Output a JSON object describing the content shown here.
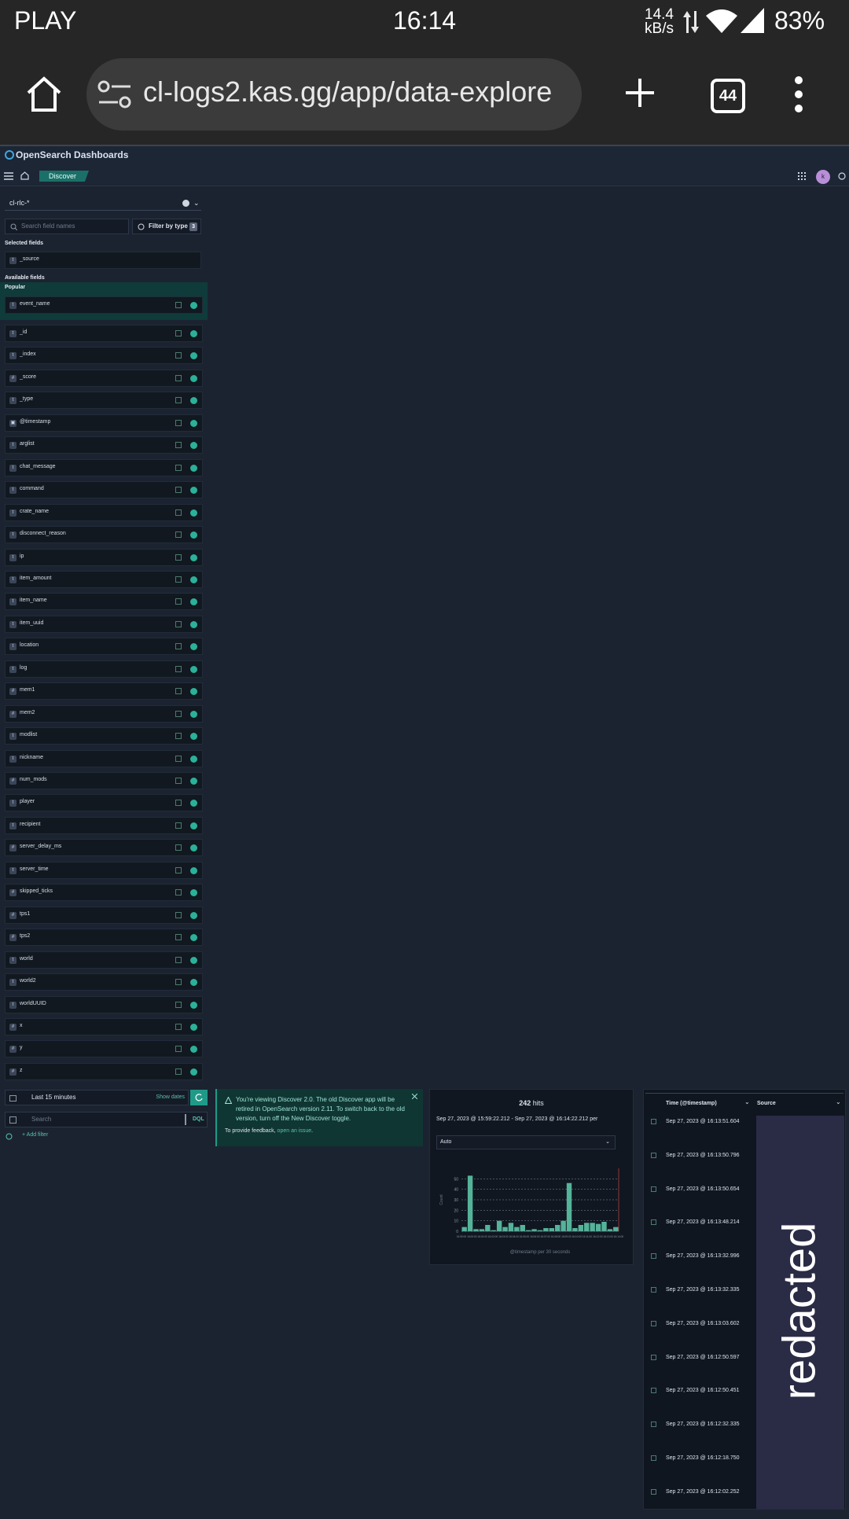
{
  "status_bar": {
    "carrier": "PLAY",
    "time": "16:14",
    "speed_value": "14.4",
    "speed_unit": "kB/s",
    "battery": "83%"
  },
  "browser": {
    "url": "cl-logs2.kas.gg/app/data-explore",
    "tab_count": "44"
  },
  "app": {
    "brand": "OpenSearch Dashboards",
    "breadcrumb": "Discover",
    "avatar_initial": "k"
  },
  "sidebar": {
    "index_pattern": "cl-rlc-*",
    "search_placeholder": "Search field names",
    "filter_by_type_label": "Filter by type",
    "filter_count": "3",
    "selected_fields_label": "Selected fields",
    "selected_fields": [
      {
        "type": "t",
        "name": "_source"
      }
    ],
    "available_fields_label": "Available fields",
    "popular_label": "Popular",
    "popular_fields": [
      {
        "type": "t",
        "name": "event_name"
      }
    ],
    "fields": [
      {
        "type": "t",
        "name": "_id"
      },
      {
        "type": "t",
        "name": "_index"
      },
      {
        "type": "#",
        "name": "_score"
      },
      {
        "type": "t",
        "name": "_type"
      },
      {
        "type": "▣",
        "name": "@timestamp"
      },
      {
        "type": "t",
        "name": "arglist"
      },
      {
        "type": "t",
        "name": "chat_message"
      },
      {
        "type": "t",
        "name": "command"
      },
      {
        "type": "t",
        "name": "crate_name"
      },
      {
        "type": "t",
        "name": "disconnect_reason"
      },
      {
        "type": "t",
        "name": "ip"
      },
      {
        "type": "t",
        "name": "item_amount"
      },
      {
        "type": "t",
        "name": "item_name"
      },
      {
        "type": "t",
        "name": "item_uuid"
      },
      {
        "type": "t",
        "name": "location"
      },
      {
        "type": "t",
        "name": "log"
      },
      {
        "type": "#",
        "name": "mem1"
      },
      {
        "type": "#",
        "name": "mem2"
      },
      {
        "type": "t",
        "name": "modlist"
      },
      {
        "type": "t",
        "name": "nickname"
      },
      {
        "type": "#",
        "name": "num_mods"
      },
      {
        "type": "t",
        "name": "player"
      },
      {
        "type": "t",
        "name": "recipient"
      },
      {
        "type": "#",
        "name": "server_delay_ms"
      },
      {
        "type": "t",
        "name": "server_time"
      },
      {
        "type": "#",
        "name": "skipped_ticks"
      },
      {
        "type": "#",
        "name": "tps1"
      },
      {
        "type": "#",
        "name": "tps2"
      },
      {
        "type": "t",
        "name": "world"
      },
      {
        "type": "t",
        "name": "world2"
      },
      {
        "type": "t",
        "name": "worldUUID"
      },
      {
        "type": "#",
        "name": "x"
      },
      {
        "type": "#",
        "name": "y"
      },
      {
        "type": "#",
        "name": "z"
      }
    ]
  },
  "query_bar": {
    "time_range": "Last 15 minutes",
    "show_dates": "Show dates",
    "search_placeholder": "Search",
    "language": "DQL",
    "add_filter": "+ Add filter"
  },
  "callout": {
    "text": "You're viewing Discover 2.0. The old Discover app will be retired in OpenSearch version 2.11. To switch back to the old version, turn off the New Discover toggle.",
    "feedback_prefix": "To provide feedback, ",
    "feedback_link": "open an issue",
    "feedback_suffix": "."
  },
  "histogram": {
    "hits_count": "242",
    "hits_label": "hits",
    "range": "Sep 27, 2023 @ 15:59:22.212 - Sep 27, 2023 @ 16:14:22.212 per",
    "interval": "Auto",
    "accent": "#54b399"
  },
  "chart_data": {
    "type": "bar",
    "title": "",
    "xlabel": "@timestamp per 30 seconds",
    "ylabel": "Count",
    "ylim": [
      0,
      60
    ],
    "yticks": [
      0,
      10,
      20,
      30,
      40,
      50
    ],
    "x_tick_labels": [
      "15:59:00",
      "16:00:00",
      "16:01:00",
      "16:02:00",
      "16:03:00",
      "16:04:00",
      "16:05:00",
      "16:06:00",
      "16:07:00",
      "16:08:00",
      "16:09:00",
      "16:10:00",
      "16:11:00",
      "16:12:00",
      "16:13:00",
      "16:14:00"
    ],
    "values": [
      4,
      53,
      2,
      2,
      6,
      1,
      10,
      4,
      8,
      4,
      6,
      1,
      2,
      1,
      3,
      3,
      6,
      10,
      46,
      3,
      6,
      8,
      8,
      7,
      9,
      2,
      4
    ]
  },
  "results": {
    "time_header": "Time (@timestamp)",
    "source_header": "Source",
    "redacted_text": "redacted",
    "rows": [
      "Sep 27, 2023 @ 16:13:51.604",
      "Sep 27, 2023 @ 16:13:50.796",
      "Sep 27, 2023 @ 16:13:50.654",
      "Sep 27, 2023 @ 16:13:48.214",
      "Sep 27, 2023 @ 16:13:32.996",
      "Sep 27, 2023 @ 16:13:32.335",
      "Sep 27, 2023 @ 16:13:03.602",
      "Sep 27, 2023 @ 16:12:50.597",
      "Sep 27, 2023 @ 16:12:50.451",
      "Sep 27, 2023 @ 16:12:32.335",
      "Sep 27, 2023 @ 16:12:18.750",
      "Sep 27, 2023 @ 16:12:02.252"
    ]
  }
}
